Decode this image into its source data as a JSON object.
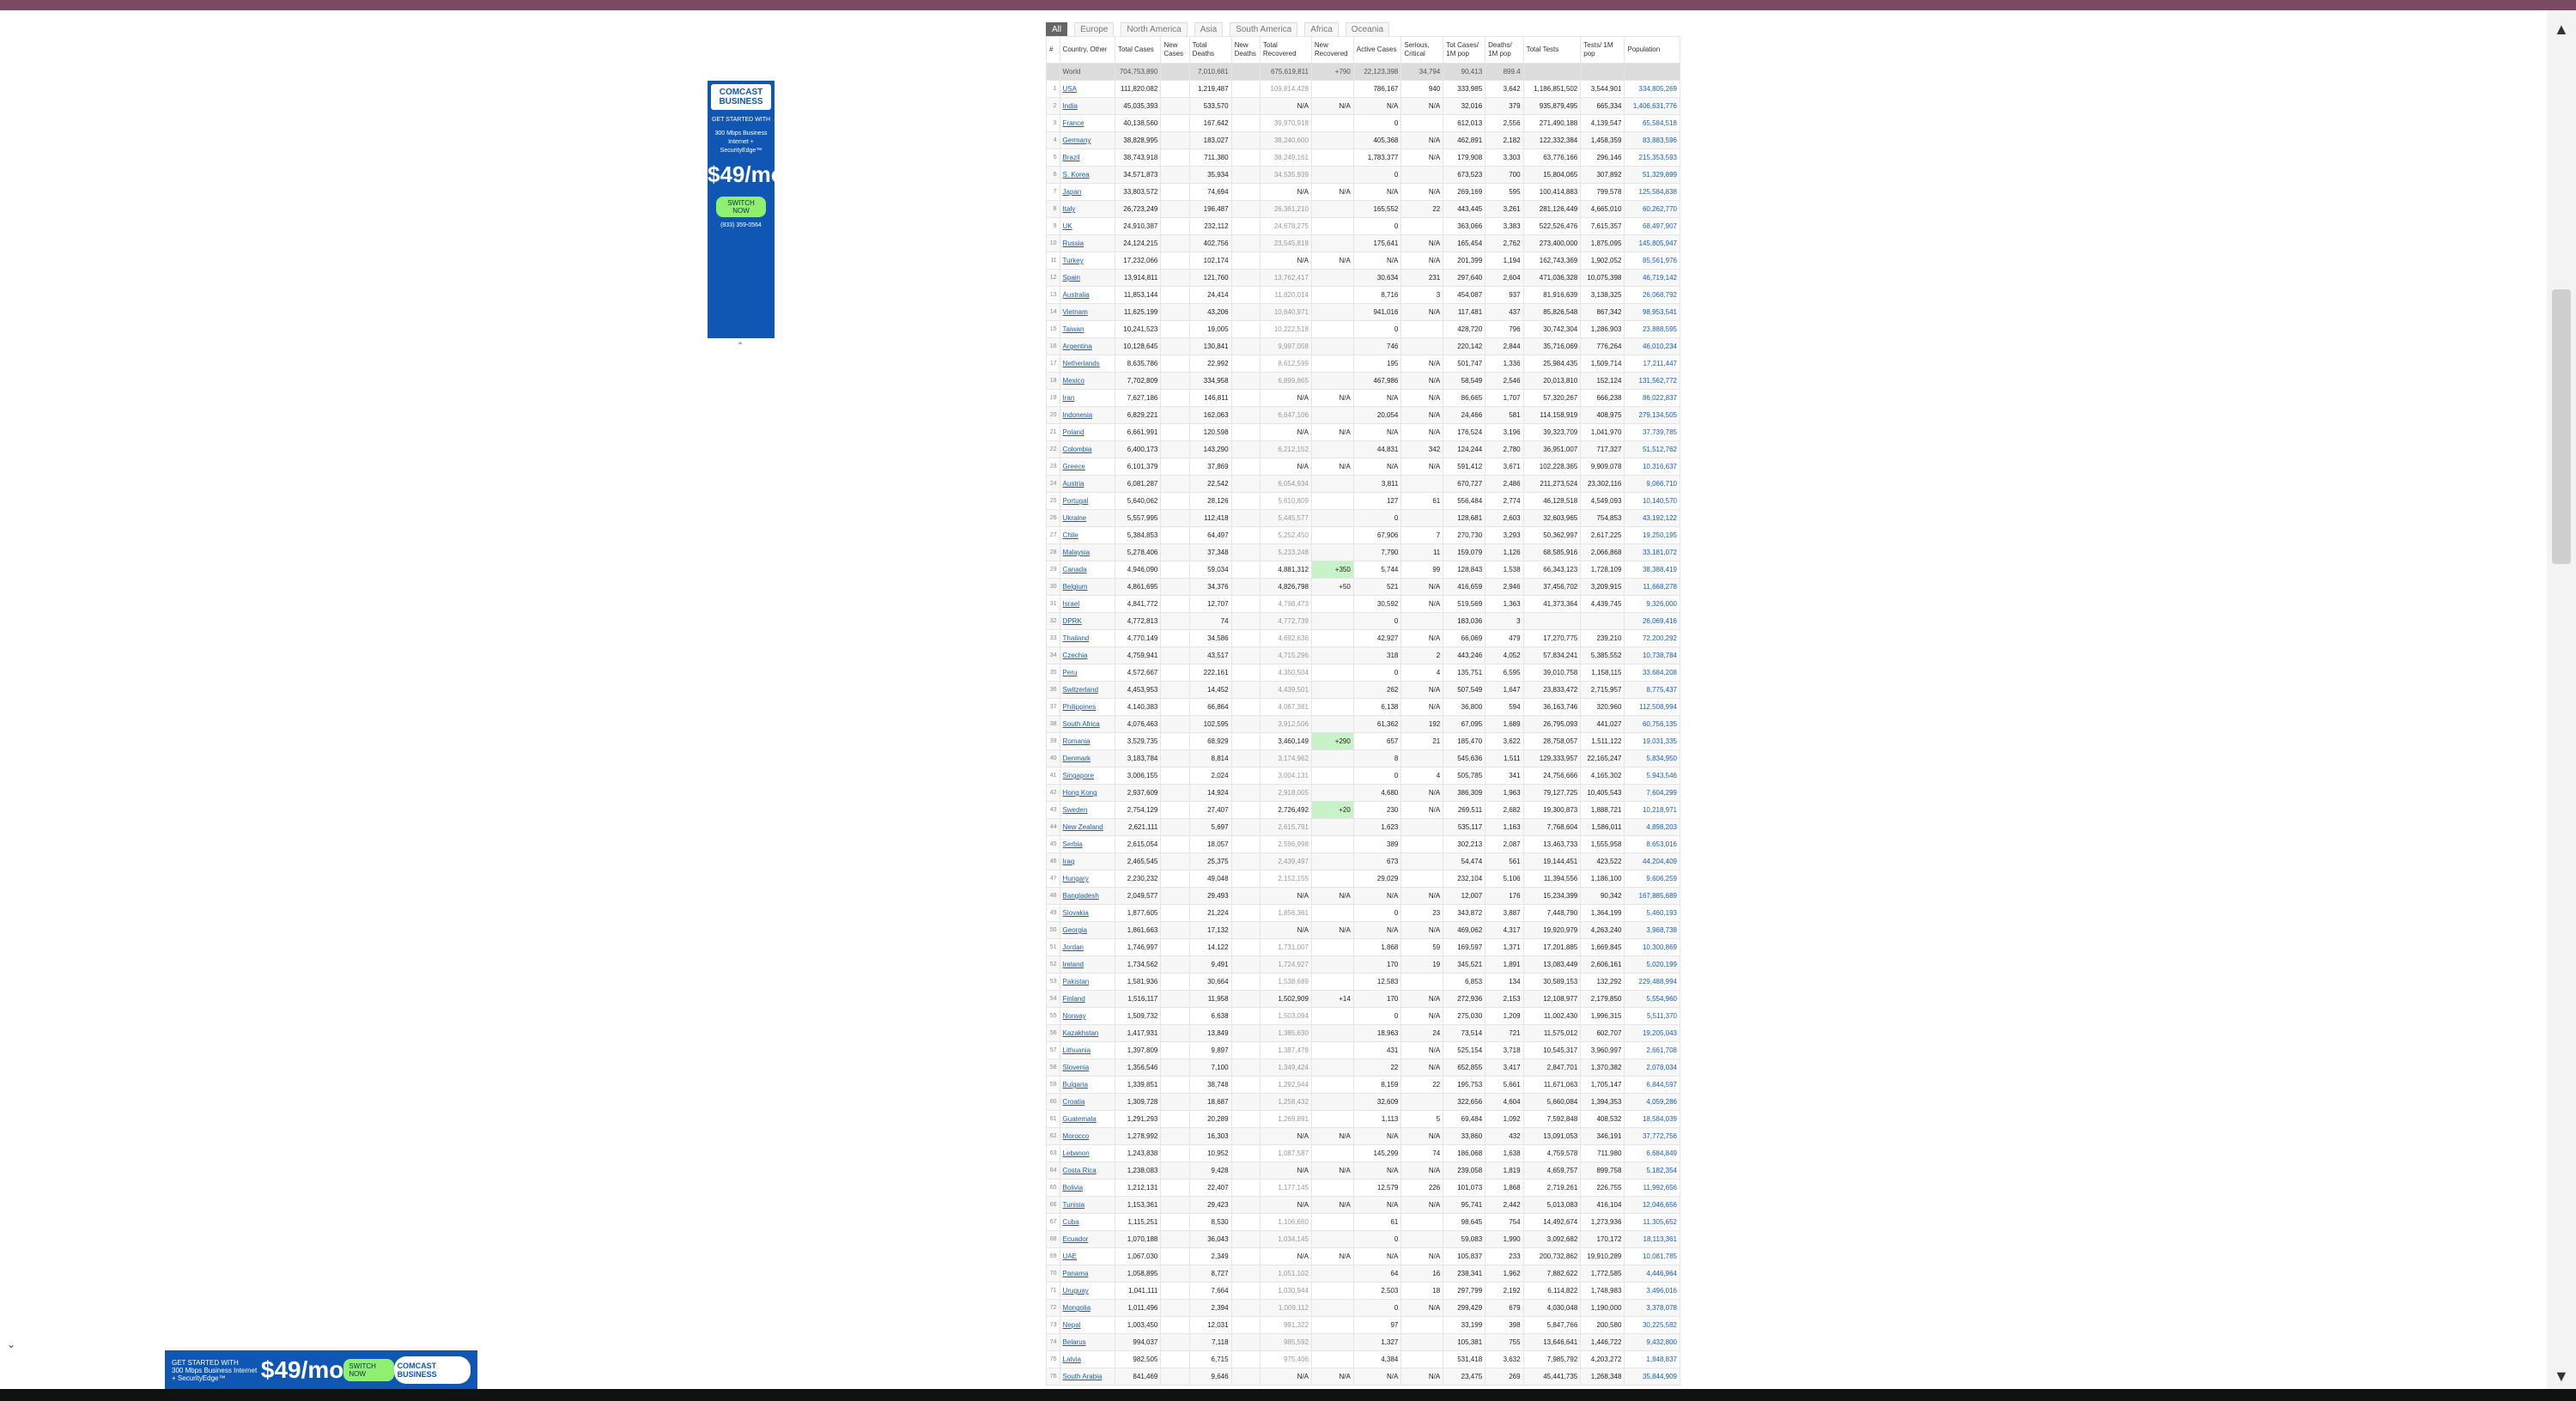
{
  "region_tabs": [
    "All",
    "Europe",
    "North America",
    "Asia",
    "South America",
    "Africa",
    "Oceania"
  ],
  "columns": [
    "#",
    "Country, Other",
    "Total Cases",
    "New Cases",
    "Total Deaths",
    "New Deaths",
    "Total Recovered",
    "New Recovered",
    "Active Cases",
    "Serious, Critical",
    "Tot Cases/ 1M pop",
    "Deaths/ 1M pop",
    "Total Tests",
    "Tests/ 1M pop",
    "Population"
  ],
  "world_row": [
    "",
    "World",
    "704,753,890",
    "",
    "7,010,681",
    "",
    "675,619,811",
    "+790",
    "22,123,398",
    "34,794",
    "90,413",
    "899.4",
    "",
    "",
    ""
  ],
  "rows": [
    [
      "1",
      "USA",
      "111,820,082",
      "",
      "1,219,487",
      "",
      "109,814,428",
      "",
      "786,167",
      "940",
      "333,985",
      "3,642",
      "1,186,851,502",
      "3,544,901",
      "334,805,269"
    ],
    [
      "2",
      "India",
      "45,035,393",
      "",
      "533,570",
      "",
      "N/A",
      "N/A",
      "N/A",
      "N/A",
      "32,016",
      "379",
      "935,879,495",
      "665,334",
      "1,406,631,776"
    ],
    [
      "3",
      "France",
      "40,138,560",
      "",
      "167,642",
      "",
      "39,970,918",
      "",
      "0",
      "",
      "612,013",
      "2,556",
      "271,490,188",
      "4,139,547",
      "65,584,518"
    ],
    [
      "4",
      "Germany",
      "38,828,995",
      "",
      "183,027",
      "",
      "38,240,600",
      "",
      "405,368",
      "N/A",
      "462,891",
      "2,182",
      "122,332,384",
      "1,458,359",
      "83,883,596"
    ],
    [
      "5",
      "Brazil",
      "38,743,918",
      "",
      "711,380",
      "",
      "38,249,161",
      "",
      "1,783,377",
      "N/A",
      "179,908",
      "3,303",
      "63,776,166",
      "296,146",
      "215,353,593"
    ],
    [
      "6",
      "S. Korea",
      "34,571,873",
      "",
      "35,934",
      "",
      "34,535,939",
      "",
      "0",
      "",
      "673,523",
      "700",
      "15,804,065",
      "307,892",
      "51,329,899"
    ],
    [
      "7",
      "Japan",
      "33,803,572",
      "",
      "74,694",
      "",
      "N/A",
      "N/A",
      "N/A",
      "N/A",
      "269,169",
      "595",
      "100,414,883",
      "799,578",
      "125,584,838"
    ],
    [
      "8",
      "Italy",
      "26,723,249",
      "",
      "196,487",
      "",
      "26,361,210",
      "",
      "165,552",
      "22",
      "443,445",
      "3,261",
      "281,126,449",
      "4,665,010",
      "60,262,770"
    ],
    [
      "9",
      "UK",
      "24,910,387",
      "",
      "232,112",
      "",
      "24,678,275",
      "",
      "0",
      "",
      "363,066",
      "3,383",
      "522,526,476",
      "7,615,357",
      "68,497,907"
    ],
    [
      "10",
      "Russia",
      "24,124,215",
      "",
      "402,756",
      "",
      "23,545,818",
      "",
      "175,641",
      "N/A",
      "165,454",
      "2,762",
      "273,400,000",
      "1,875,095",
      "145,805,947"
    ],
    [
      "11",
      "Turkey",
      "17,232,066",
      "",
      "102,174",
      "",
      "N/A",
      "N/A",
      "N/A",
      "N/A",
      "201,399",
      "1,194",
      "162,743,369",
      "1,902,052",
      "85,561,976"
    ],
    [
      "12",
      "Spain",
      "13,914,811",
      "",
      "121,760",
      "",
      "13,762,417",
      "",
      "30,634",
      "231",
      "297,640",
      "2,604",
      "471,036,328",
      "10,075,398",
      "46,719,142"
    ],
    [
      "13",
      "Australia",
      "11,853,144",
      "",
      "24,414",
      "",
      "11,820,014",
      "",
      "8,716",
      "3",
      "454,087",
      "937",
      "81,916,639",
      "3,138,325",
      "26,068,792"
    ],
    [
      "14",
      "Vietnam",
      "11,625,199",
      "",
      "43,206",
      "",
      "10,640,971",
      "",
      "941,016",
      "N/A",
      "117,481",
      "437",
      "85,826,548",
      "867,342",
      "98,953,541"
    ],
    [
      "15",
      "Taiwan",
      "10,241,523",
      "",
      "19,005",
      "",
      "10,222,518",
      "",
      "0",
      "",
      "428,720",
      "796",
      "30,742,304",
      "1,286,903",
      "23,888,595"
    ],
    [
      "16",
      "Argentina",
      "10,128,645",
      "",
      "130,841",
      "",
      "9,997,058",
      "",
      "746",
      "",
      "220,142",
      "2,844",
      "35,716,069",
      "776,264",
      "46,010,234"
    ],
    [
      "17",
      "Netherlands",
      "8,635,786",
      "",
      "22,992",
      "",
      "8,612,599",
      "",
      "195",
      "N/A",
      "501,747",
      "1,336",
      "25,984,435",
      "1,509,714",
      "17,211,447"
    ],
    [
      "18",
      "Mexico",
      "7,702,809",
      "",
      "334,958",
      "",
      "6,899,865",
      "",
      "467,986",
      "N/A",
      "58,549",
      "2,546",
      "20,013,810",
      "152,124",
      "131,562,772"
    ],
    [
      "19",
      "Iran",
      "7,627,186",
      "",
      "146,811",
      "",
      "N/A",
      "N/A",
      "N/A",
      "N/A",
      "86,665",
      "1,707",
      "57,320,267",
      "666,238",
      "86,022,837"
    ],
    [
      "20",
      "Indonesia",
      "6,829,221",
      "",
      "162,063",
      "",
      "6,647,106",
      "",
      "20,054",
      "N/A",
      "24,466",
      "581",
      "114,158,919",
      "408,975",
      "279,134,505"
    ],
    [
      "21",
      "Poland",
      "6,661,991",
      "",
      "120,598",
      "",
      "N/A",
      "N/A",
      "N/A",
      "N/A",
      "176,524",
      "3,196",
      "39,323,709",
      "1,041,970",
      "37,739,785"
    ],
    [
      "22",
      "Colombia",
      "6,400,173",
      "",
      "143,290",
      "",
      "6,212,152",
      "",
      "44,831",
      "342",
      "124,244",
      "2,780",
      "36,951,007",
      "717,327",
      "51,512,762"
    ],
    [
      "23",
      "Greece",
      "6,101,379",
      "",
      "37,869",
      "",
      "N/A",
      "N/A",
      "N/A",
      "N/A",
      "591,412",
      "3,671",
      "102,228,365",
      "9,909,078",
      "10,316,637"
    ],
    [
      "24",
      "Austria",
      "6,081,287",
      "",
      "22,542",
      "",
      "6,054,934",
      "",
      "3,811",
      "",
      "670,727",
      "2,486",
      "211,273,524",
      "23,302,116",
      "9,066,710"
    ],
    [
      "25",
      "Portugal",
      "5,640,062",
      "",
      "28,126",
      "",
      "5,610,809",
      "",
      "127",
      "61",
      "556,484",
      "2,774",
      "46,128,518",
      "4,549,093",
      "10,140,570"
    ],
    [
      "26",
      "Ukraine",
      "5,557,995",
      "",
      "112,418",
      "",
      "5,445,577",
      "",
      "0",
      "",
      "128,681",
      "2,603",
      "32,603,965",
      "754,853",
      "43,192,122"
    ],
    [
      "27",
      "Chile",
      "5,384,853",
      "",
      "64,497",
      "",
      "5,252,450",
      "",
      "67,906",
      "7",
      "270,730",
      "3,293",
      "50,362,997",
      "2,617,225",
      "19,250,195"
    ],
    [
      "28",
      "Malaysia",
      "5,278,406",
      "",
      "37,348",
      "",
      "5,233,248",
      "",
      "7,790",
      "11",
      "159,079",
      "1,126",
      "68,585,916",
      "2,066,868",
      "33,181,072"
    ],
    [
      "29",
      "Canada",
      "4,946,090",
      "",
      "59,034",
      "",
      "4,881,312",
      "+350",
      "5,744",
      "99",
      "128,843",
      "1,538",
      "66,343,123",
      "1,728,109",
      "38,388,419"
    ],
    [
      "30",
      "Belgium",
      "4,861,695",
      "",
      "34,376",
      "",
      "4,826,798",
      "+50",
      "521",
      "N/A",
      "416,659",
      "2,946",
      "37,456,702",
      "3,209,915",
      "11,668,278"
    ],
    [
      "31",
      "Israel",
      "4,841,772",
      "",
      "12,707",
      "",
      "4,798,473",
      "",
      "30,592",
      "N/A",
      "519,569",
      "1,363",
      "41,373,364",
      "4,439,745",
      "9,326,000"
    ],
    [
      "32",
      "DPRK",
      "4,772,813",
      "",
      "74",
      "",
      "4,772,739",
      "",
      "0",
      "",
      "183,036",
      "3",
      "",
      "",
      "26,069,416"
    ],
    [
      "33",
      "Thailand",
      "4,770,149",
      "",
      "34,586",
      "",
      "4,692,636",
      "",
      "42,927",
      "N/A",
      "66,069",
      "479",
      "17,270,775",
      "239,210",
      "72,200,292"
    ],
    [
      "34",
      "Czechia",
      "4,759,941",
      "",
      "43,517",
      "",
      "4,715,296",
      "",
      "318",
      "2",
      "443,246",
      "4,052",
      "57,834,241",
      "5,385,552",
      "10,738,784"
    ],
    [
      "35",
      "Peru",
      "4,572,667",
      "",
      "222,161",
      "",
      "4,350,504",
      "",
      "0",
      "4",
      "135,751",
      "6,595",
      "39,010,758",
      "1,158,115",
      "33,684,208"
    ],
    [
      "36",
      "Switzerland",
      "4,453,953",
      "",
      "14,452",
      "",
      "4,439,501",
      "",
      "262",
      "N/A",
      "507,549",
      "1,647",
      "23,833,472",
      "2,715,957",
      "8,775,437"
    ],
    [
      "37",
      "Philippines",
      "4,140,383",
      "",
      "66,864",
      "",
      "4,067,381",
      "",
      "6,138",
      "N/A",
      "36,800",
      "594",
      "36,163,746",
      "320,960",
      "112,508,994"
    ],
    [
      "38",
      "South Africa",
      "4,076,463",
      "",
      "102,595",
      "",
      "3,912,506",
      "",
      "61,362",
      "192",
      "67,095",
      "1,689",
      "26,795,093",
      "441,027",
      "60,756,135"
    ],
    [
      "39",
      "Romania",
      "3,529,735",
      "",
      "68,929",
      "",
      "3,460,149",
      "+290",
      "657",
      "21",
      "185,470",
      "3,622",
      "28,758,057",
      "1,511,122",
      "19,031,335"
    ],
    [
      "40",
      "Denmark",
      "3,183,784",
      "",
      "8,814",
      "",
      "3,174,962",
      "",
      "8",
      "",
      "545,636",
      "1,511",
      "129,333,957",
      "22,165,247",
      "5,834,950"
    ],
    [
      "41",
      "Singapore",
      "3,006,155",
      "",
      "2,024",
      "",
      "3,004,131",
      "",
      "0",
      "4",
      "505,785",
      "341",
      "24,756,666",
      "4,165,302",
      "5,943,546"
    ],
    [
      "42",
      "Hong Kong",
      "2,937,609",
      "",
      "14,924",
      "",
      "2,918,005",
      "",
      "4,680",
      "N/A",
      "386,309",
      "1,963",
      "79,127,725",
      "10,405,543",
      "7,604,299"
    ],
    [
      "43",
      "Sweden",
      "2,754,129",
      "",
      "27,407",
      "",
      "2,726,492",
      "+20",
      "230",
      "N/A",
      "269,511",
      "2,682",
      "19,300,873",
      "1,888,721",
      "10,218,971"
    ],
    [
      "44",
      "New Zealand",
      "2,621,111",
      "",
      "5,697",
      "",
      "2,615,791",
      "",
      "1,623",
      "",
      "535,117",
      "1,163",
      "7,768,604",
      "1,586,011",
      "4,898,203"
    ],
    [
      "45",
      "Serbia",
      "2,615,054",
      "",
      "18,057",
      "",
      "2,596,998",
      "",
      "389",
      "",
      "302,213",
      "2,087",
      "13,463,733",
      "1,555,958",
      "8,653,016"
    ],
    [
      "46",
      "Iraq",
      "2,465,545",
      "",
      "25,375",
      "",
      "2,439,497",
      "",
      "673",
      "",
      "54,474",
      "561",
      "19,144,451",
      "423,522",
      "44,204,409"
    ],
    [
      "47",
      "Hungary",
      "2,230,232",
      "",
      "49,048",
      "",
      "2,152,155",
      "",
      "29,029",
      "",
      "232,104",
      "5,106",
      "11,394,556",
      "1,186,100",
      "9,606,259"
    ],
    [
      "48",
      "Bangladesh",
      "2,049,577",
      "",
      "29,493",
      "",
      "N/A",
      "N/A",
      "N/A",
      "N/A",
      "12,007",
      "176",
      "15,234,399",
      "90,342",
      "167,885,689"
    ],
    [
      "49",
      "Slovakia",
      "1,877,605",
      "",
      "21,224",
      "",
      "1,856,361",
      "",
      "0",
      "23",
      "343,872",
      "3,887",
      "7,448,790",
      "1,364,199",
      "5,460,193"
    ],
    [
      "50",
      "Georgia",
      "1,861,663",
      "",
      "17,132",
      "",
      "N/A",
      "N/A",
      "N/A",
      "N/A",
      "469,062",
      "4,317",
      "19,920,979",
      "4,263,240",
      "3,968,738"
    ],
    [
      "51",
      "Jordan",
      "1,746,997",
      "",
      "14,122",
      "",
      "1,731,007",
      "",
      "1,868",
      "59",
      "169,597",
      "1,371",
      "17,201,885",
      "1,669,845",
      "10,300,869"
    ],
    [
      "52",
      "Ireland",
      "1,734,562",
      "",
      "9,491",
      "",
      "1,724,927",
      "",
      "170",
      "19",
      "345,521",
      "1,891",
      "13,083,449",
      "2,606,161",
      "5,020,199"
    ],
    [
      "53",
      "Pakistan",
      "1,581,936",
      "",
      "30,664",
      "",
      "1,538,689",
      "",
      "12,583",
      "",
      "6,853",
      "134",
      "30,589,153",
      "132,292",
      "229,488,994"
    ],
    [
      "54",
      "Finland",
      "1,516,117",
      "",
      "11,958",
      "",
      "1,502,909",
      "+14",
      "170",
      "N/A",
      "272,936",
      "2,153",
      "12,108,977",
      "2,179,850",
      "5,554,960"
    ],
    [
      "55",
      "Norway",
      "1,509,732",
      "",
      "6,638",
      "",
      "1,503,094",
      "",
      "0",
      "N/A",
      "275,030",
      "1,209",
      "11,002,430",
      "1,996,315",
      "5,511,370"
    ],
    [
      "56",
      "Kazakhstan",
      "1,417,931",
      "",
      "13,849",
      "",
      "1,385,630",
      "",
      "18,963",
      "24",
      "73,514",
      "721",
      "11,575,012",
      "602,707",
      "19,205,043"
    ],
    [
      "57",
      "Lithuania",
      "1,397,809",
      "",
      "9,897",
      "",
      "1,387,478",
      "",
      "431",
      "N/A",
      "525,154",
      "3,718",
      "10,545,317",
      "3,960,997",
      "2,661,708"
    ],
    [
      "58",
      "Slovenia",
      "1,356,546",
      "",
      "7,100",
      "",
      "1,349,424",
      "",
      "22",
      "N/A",
      "652,855",
      "3,417",
      "2,847,701",
      "1,370,382",
      "2,078,034"
    ],
    [
      "59",
      "Bulgaria",
      "1,339,851",
      "",
      "38,748",
      "",
      "1,292,944",
      "",
      "8,159",
      "22",
      "195,753",
      "5,661",
      "11,671,063",
      "1,705,147",
      "6,844,597"
    ],
    [
      "60",
      "Croatia",
      "1,309,728",
      "",
      "18,687",
      "",
      "1,258,432",
      "",
      "32,609",
      "",
      "322,656",
      "4,604",
      "5,660,084",
      "1,394,353",
      "4,059,286"
    ],
    [
      "61",
      "Guatemala",
      "1,291,293",
      "",
      "20,289",
      "",
      "1,269,891",
      "",
      "1,113",
      "5",
      "69,484",
      "1,092",
      "7,592,848",
      "408,532",
      "18,584,039"
    ],
    [
      "62",
      "Morocco",
      "1,278,992",
      "",
      "16,303",
      "",
      "N/A",
      "N/A",
      "N/A",
      "N/A",
      "33,860",
      "432",
      "13,091,053",
      "346,191",
      "37,772,756"
    ],
    [
      "63",
      "Lebanon",
      "1,243,838",
      "",
      "10,952",
      "",
      "1,087,587",
      "",
      "145,299",
      "74",
      "186,068",
      "1,638",
      "4,759,578",
      "711,980",
      "6,684,849"
    ],
    [
      "64",
      "Costa Rica",
      "1,238,083",
      "",
      "9,428",
      "",
      "N/A",
      "N/A",
      "N/A",
      "N/A",
      "239,058",
      "1,819",
      "4,659,757",
      "899,758",
      "5,182,354"
    ],
    [
      "65",
      "Bolivia",
      "1,212,131",
      "",
      "22,407",
      "",
      "1,177,145",
      "",
      "12,579",
      "226",
      "101,073",
      "1,868",
      "2,719,261",
      "226,755",
      "11,992,656"
    ],
    [
      "66",
      "Tunisia",
      "1,153,361",
      "",
      "29,423",
      "",
      "N/A",
      "N/A",
      "N/A",
      "N/A",
      "95,741",
      "2,442",
      "5,013,083",
      "416,104",
      "12,046,656"
    ],
    [
      "67",
      "Cuba",
      "1,115,251",
      "",
      "8,530",
      "",
      "1,106,660",
      "",
      "61",
      "",
      "98,645",
      "754",
      "14,492,674",
      "1,273,936",
      "11,305,652"
    ],
    [
      "68",
      "Ecuador",
      "1,070,188",
      "",
      "36,043",
      "",
      "1,034,145",
      "",
      "0",
      "",
      "59,083",
      "1,990",
      "3,092,682",
      "170,172",
      "18,113,361"
    ],
    [
      "69",
      "UAE",
      "1,067,030",
      "",
      "2,349",
      "",
      "N/A",
      "N/A",
      "N/A",
      "N/A",
      "105,837",
      "233",
      "200,732,862",
      "19,910,289",
      "10,081,785"
    ],
    [
      "70",
      "Panama",
      "1,058,895",
      "",
      "8,727",
      "",
      "1,051,102",
      "",
      "64",
      "16",
      "238,341",
      "1,962",
      "7,882,622",
      "1,772,585",
      "4,446,964"
    ],
    [
      "71",
      "Uruguay",
      "1,041,111",
      "",
      "7,664",
      "",
      "1,030,944",
      "",
      "2,503",
      "18",
      "297,799",
      "2,192",
      "6,114,822",
      "1,748,983",
      "3,496,016"
    ],
    [
      "72",
      "Mongolia",
      "1,011,496",
      "",
      "2,394",
      "",
      "1,009,112",
      "",
      "0",
      "N/A",
      "299,429",
      "679",
      "4,030,048",
      "1,190,000",
      "3,378,078"
    ],
    [
      "73",
      "Nepal",
      "1,003,450",
      "",
      "12,031",
      "",
      "991,322",
      "",
      "97",
      "",
      "33,199",
      "398",
      "5,847,766",
      "200,580",
      "30,225,582"
    ],
    [
      "74",
      "Belarus",
      "994,037",
      "",
      "7,118",
      "",
      "985,592",
      "",
      "1,327",
      "",
      "105,381",
      "755",
      "13,646,641",
      "1,446,722",
      "9,432,800"
    ],
    [
      "75",
      "Latvia",
      "982,505",
      "",
      "6,715",
      "",
      "975,406",
      "",
      "4,384",
      "",
      "531,418",
      "3,632",
      "7,985,792",
      "4,203,272",
      "1,848,837"
    ],
    [
      "76",
      "South Arabia",
      "841,469",
      "",
      "9,646",
      "",
      "N/A",
      "N/A",
      "N/A",
      "N/A",
      "23,475",
      "269",
      "45,441,735",
      "1,268,348",
      "35,844,909"
    ]
  ],
  "ads": {
    "side": {
      "brand": "COMCAST BUSINESS",
      "line1": "GET STARTED WITH",
      "line2": "300 Mbps Business Internet + SecurityEdge™",
      "price": "$49/mo",
      "cta": "SWITCH NOW",
      "phone": "(833) 359-0564"
    },
    "bottom": {
      "line1": "GET STARTED WITH",
      "line2": "300 Mbps Business Internet + SecurityEdge™",
      "price": "$49/mo",
      "cta": "SWITCH NOW",
      "brand": "COMCAST BUSINESS"
    }
  }
}
